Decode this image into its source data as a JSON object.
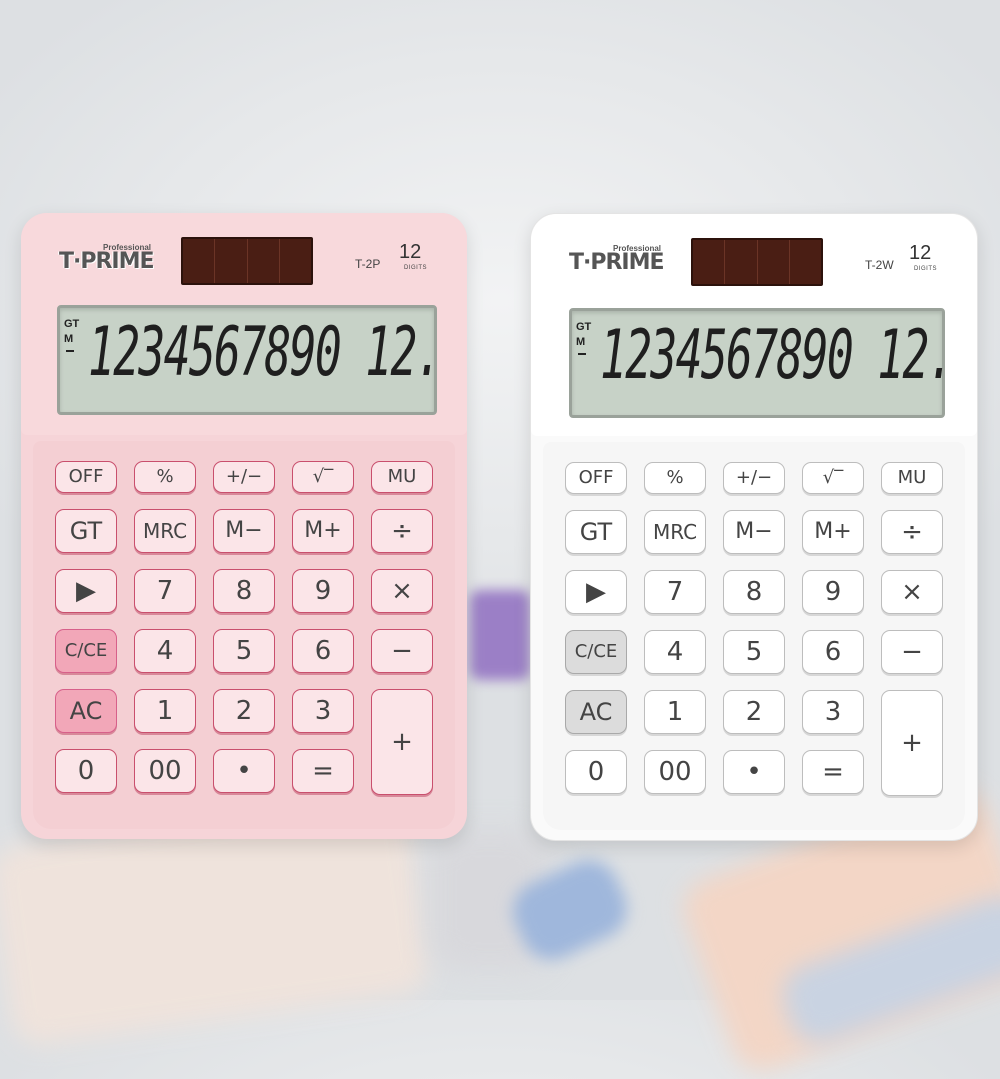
{
  "calculators": [
    {
      "id": "pink",
      "color": "#f6d4d8",
      "brand_small": "Professional",
      "brand": "T·PRIME",
      "model": "T-2P",
      "digits_number": "12",
      "digits_label": "DIGITS",
      "display_indicators": [
        "GT",
        "M"
      ],
      "display_value": "1234567890 12.",
      "keys": {
        "off": "OFF",
        "percent": "%",
        "plus_minus": "+/−",
        "sqrt": "√‾",
        "mu": "MU",
        "gt": "GT",
        "mrc": "MRC",
        "m_minus": "M−",
        "m_plus": "M+",
        "divide": "÷",
        "backspace": "▶",
        "seven": "7",
        "eight": "8",
        "nine": "9",
        "multiply": "×",
        "c_ce": "C/CE",
        "four": "4",
        "five": "5",
        "six": "6",
        "minus": "−",
        "ac": "AC",
        "one": "1",
        "two": "2",
        "three": "3",
        "plus": "+",
        "zero": "0",
        "double_zero": "00",
        "dot": "•",
        "equals": "="
      }
    },
    {
      "id": "white",
      "color": "#fafafa",
      "brand_small": "Professional",
      "brand": "T·PRIME",
      "model": "T-2W",
      "digits_number": "12",
      "digits_label": "DIGITS",
      "display_indicators": [
        "GT",
        "M"
      ],
      "display_value": "1234567890 12.",
      "keys": {
        "off": "OFF",
        "percent": "%",
        "plus_minus": "+/−",
        "sqrt": "√‾",
        "mu": "MU",
        "gt": "GT",
        "mrc": "MRC",
        "m_minus": "M−",
        "m_plus": "M+",
        "divide": "÷",
        "backspace": "▶",
        "seven": "7",
        "eight": "8",
        "nine": "9",
        "multiply": "×",
        "c_ce": "C/CE",
        "four": "4",
        "five": "5",
        "six": "6",
        "minus": "−",
        "ac": "AC",
        "one": "1",
        "two": "2",
        "three": "3",
        "plus": "+",
        "zero": "0",
        "double_zero": "00",
        "dot": "•",
        "equals": "="
      }
    }
  ]
}
